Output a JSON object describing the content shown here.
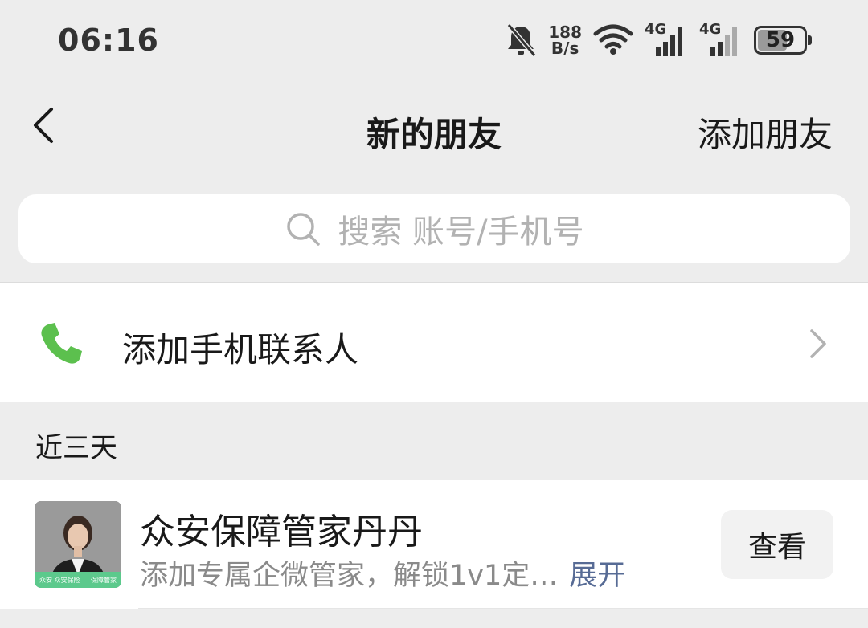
{
  "status_bar": {
    "time": "06:16",
    "net_speed_value": "188",
    "net_speed_unit": "B/s",
    "signal_1_label": "4G",
    "signal_2_label": "4G",
    "battery": "59",
    "icons": [
      "bell-muted-icon",
      "wifi-icon",
      "signal-icon",
      "signal-icon",
      "battery-icon"
    ]
  },
  "nav": {
    "title": "新的朋友",
    "action": "添加朋友",
    "back_icon": "chevron-left-icon"
  },
  "search": {
    "placeholder": "搜索 账号/手机号",
    "icon": "search-icon"
  },
  "add_phone_contacts": {
    "label": "添加手机联系人",
    "icon": "phone-icon",
    "accent_color": "#5cc04e"
  },
  "section": {
    "title": "近三天"
  },
  "requests": [
    {
      "name": "众安保障管家丹丹",
      "message": "添加专属企微管家，解锁1v1定…",
      "expand": "展开",
      "button": "查看",
      "avatar_badge_left": "众安 众安保险",
      "avatar_badge_right": "保障管家",
      "link_color": "#576b95"
    }
  ]
}
